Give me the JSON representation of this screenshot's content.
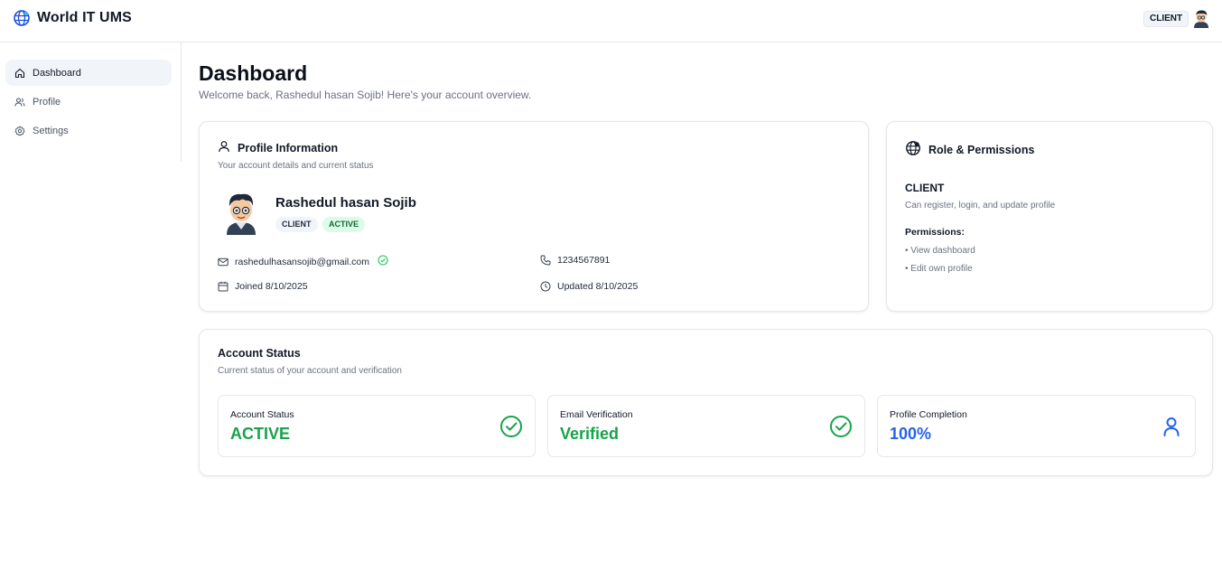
{
  "app": {
    "title": "World IT UMS",
    "role_pill": "CLIENT"
  },
  "sidebar": {
    "items": [
      {
        "label": "Dashboard",
        "icon": "home-icon",
        "active": true
      },
      {
        "label": "Profile",
        "icon": "users-icon",
        "active": false
      },
      {
        "label": "Settings",
        "icon": "gear-icon",
        "active": false
      }
    ]
  },
  "page": {
    "title": "Dashboard",
    "subtitle": "Welcome back, Rashedul hasan Sojib! Here's your account overview."
  },
  "profile_card": {
    "title": "Profile Information",
    "subtitle": "Your account details and current status",
    "name": "Rashedul hasan Sojib",
    "role_badge": "CLIENT",
    "status_badge": "ACTIVE",
    "email": "rashedulhasansojib@gmail.com",
    "phone": "1234567891",
    "joined": "Joined 8/10/2025",
    "updated": "Updated 8/10/2025"
  },
  "role_card": {
    "title": "Role & Permissions",
    "role": "CLIENT",
    "description": "Can register, login, and update profile",
    "permissions_title": "Permissions:",
    "permissions": [
      "• View dashboard",
      "• Edit own profile"
    ]
  },
  "status_card": {
    "title": "Account Status",
    "subtitle": "Current status of your account and verification",
    "stats": [
      {
        "label": "Account Status",
        "value": "ACTIVE",
        "color": "#16a34a",
        "icon": "check-circle-icon"
      },
      {
        "label": "Email Verification",
        "value": "Verified",
        "color": "#16a34a",
        "icon": "check-circle-icon"
      },
      {
        "label": "Profile Completion",
        "value": "100%",
        "color": "#2563eb",
        "icon": "user-icon"
      }
    ]
  }
}
